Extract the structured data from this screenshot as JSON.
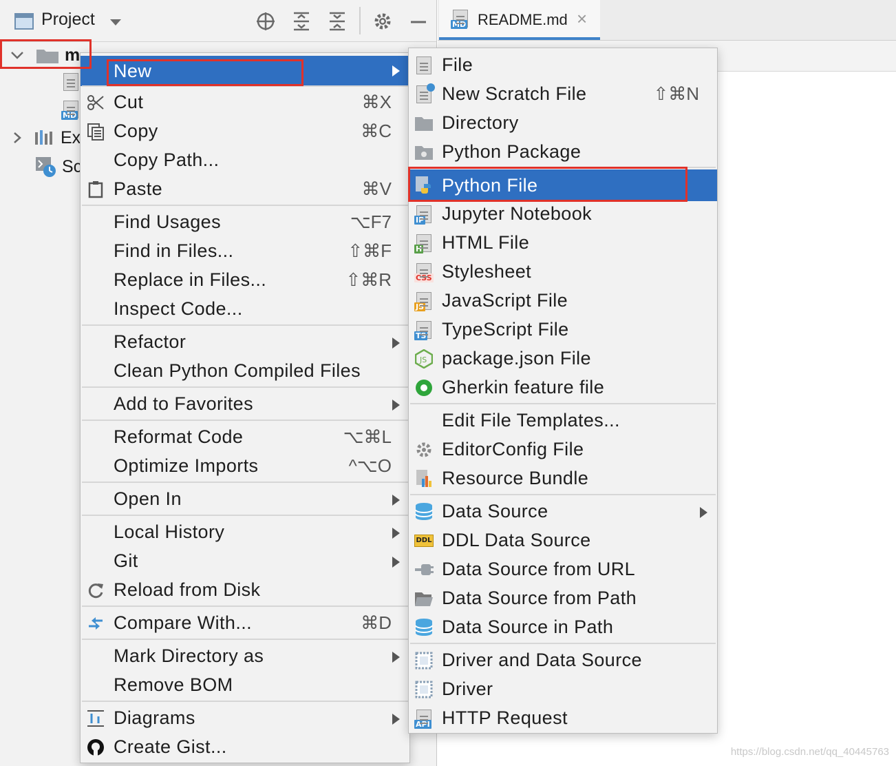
{
  "toolbar": {
    "title": "Project",
    "icons": [
      "locate-icon",
      "expand-all-icon",
      "collapse-all-icon",
      "gear-icon",
      "minimize-icon"
    ]
  },
  "tabs": [
    {
      "label": "README.md",
      "icon": "markdown-file-icon"
    }
  ],
  "tree": {
    "root_label_visible": "m",
    "items": [
      {
        "label": "Ex",
        "icon": "external-libraries-icon"
      },
      {
        "label": "Sc",
        "icon": "scratches-icon"
      }
    ]
  },
  "context_menu": {
    "items": [
      {
        "label": "New",
        "shortcut": "",
        "submenu": true,
        "icon": "",
        "selected": true
      },
      {
        "label": "Cut",
        "shortcut": "⌘X",
        "icon": "scissors-icon"
      },
      {
        "label": "Copy",
        "shortcut": "⌘C",
        "icon": "copy-icon"
      },
      {
        "label": "Copy Path...",
        "shortcut": "",
        "icon": ""
      },
      {
        "label": "Paste",
        "shortcut": "⌘V",
        "icon": "clipboard-icon"
      },
      {
        "label": "Find Usages",
        "shortcut": "⌥F7",
        "icon": ""
      },
      {
        "label": "Find in Files...",
        "shortcut": "⇧⌘F",
        "icon": ""
      },
      {
        "label": "Replace in Files...",
        "shortcut": "⇧⌘R",
        "icon": ""
      },
      {
        "label": "Inspect Code...",
        "shortcut": "",
        "icon": ""
      },
      {
        "label": "Refactor",
        "submenu": true,
        "icon": ""
      },
      {
        "label": "Clean Python Compiled Files",
        "shortcut": "",
        "icon": ""
      },
      {
        "label": "Add to Favorites",
        "submenu": true,
        "icon": ""
      },
      {
        "label": "Reformat Code",
        "shortcut": "⌥⌘L",
        "icon": ""
      },
      {
        "label": "Optimize Imports",
        "shortcut": "^⌥O",
        "icon": ""
      },
      {
        "label": "Open In",
        "submenu": true,
        "icon": ""
      },
      {
        "label": "Local History",
        "submenu": true,
        "icon": ""
      },
      {
        "label": "Git",
        "submenu": true,
        "icon": ""
      },
      {
        "label": "Reload from Disk",
        "shortcut": "",
        "icon": "reload-icon"
      },
      {
        "label": "Compare With...",
        "shortcut": "⌘D",
        "icon": "compare-icon"
      },
      {
        "label": "Mark Directory as",
        "submenu": true,
        "icon": ""
      },
      {
        "label": "Remove BOM",
        "shortcut": "",
        "icon": ""
      },
      {
        "label": "Diagrams",
        "submenu": true,
        "icon": "diagram-icon"
      },
      {
        "label": "Create Gist...",
        "shortcut": "",
        "icon": "github-icon"
      }
    ]
  },
  "new_submenu": {
    "items": [
      {
        "label": "File",
        "shortcut": "",
        "icon": "file-icon"
      },
      {
        "label": "New Scratch File",
        "shortcut": "⇧⌘N",
        "icon": "scratch-file-icon"
      },
      {
        "label": "Directory",
        "shortcut": "",
        "icon": "folder-icon"
      },
      {
        "label": "Python Package",
        "shortcut": "",
        "icon": "python-package-icon"
      },
      {
        "label": "Python File",
        "shortcut": "",
        "icon": "python-file-icon",
        "selected": true
      },
      {
        "label": "Jupyter Notebook",
        "shortcut": "",
        "icon": "jupyter-icon",
        "tag": "IP"
      },
      {
        "label": "HTML File",
        "shortcut": "",
        "icon": "html-file-icon",
        "tag": "H"
      },
      {
        "label": "Stylesheet",
        "shortcut": "",
        "icon": "css-file-icon",
        "tag": "CSS"
      },
      {
        "label": "JavaScript File",
        "shortcut": "",
        "icon": "js-file-icon",
        "tag": "JS"
      },
      {
        "label": "TypeScript File",
        "shortcut": "",
        "icon": "ts-file-icon",
        "tag": "TS"
      },
      {
        "label": "package.json File",
        "shortcut": "",
        "icon": "nodejs-icon"
      },
      {
        "label": "Gherkin feature file",
        "shortcut": "",
        "icon": "cucumber-icon"
      },
      {
        "label": "Edit File Templates...",
        "shortcut": "",
        "icon": ""
      },
      {
        "label": "EditorConfig File",
        "shortcut": "",
        "icon": "gear-icon"
      },
      {
        "label": "Resource Bundle",
        "shortcut": "",
        "icon": "resource-bundle-icon"
      },
      {
        "label": "Data Source",
        "submenu": true,
        "icon": "database-icon"
      },
      {
        "label": "DDL Data Source",
        "shortcut": "",
        "icon": "ddl-icon",
        "tag": "DDL"
      },
      {
        "label": "Data Source from URL",
        "shortcut": "",
        "icon": "plug-icon"
      },
      {
        "label": "Data Source from Path",
        "shortcut": "",
        "icon": "open-folder-icon"
      },
      {
        "label": "Data Source in Path",
        "shortcut": "",
        "icon": "database-icon"
      },
      {
        "label": "Driver and Data Source",
        "shortcut": "",
        "icon": "driver-icon"
      },
      {
        "label": "Driver",
        "shortcut": "",
        "icon": "driver-icon"
      },
      {
        "label": "HTTP Request",
        "shortcut": "",
        "icon": "api-file-icon",
        "tag": "API"
      }
    ]
  },
  "watermark": "https://blog.csdn.net/qq_40445763",
  "colors": {
    "selection": "#2f6fc1",
    "highlight_box": "#e0322a",
    "menu_bg": "#f2f2f2"
  }
}
